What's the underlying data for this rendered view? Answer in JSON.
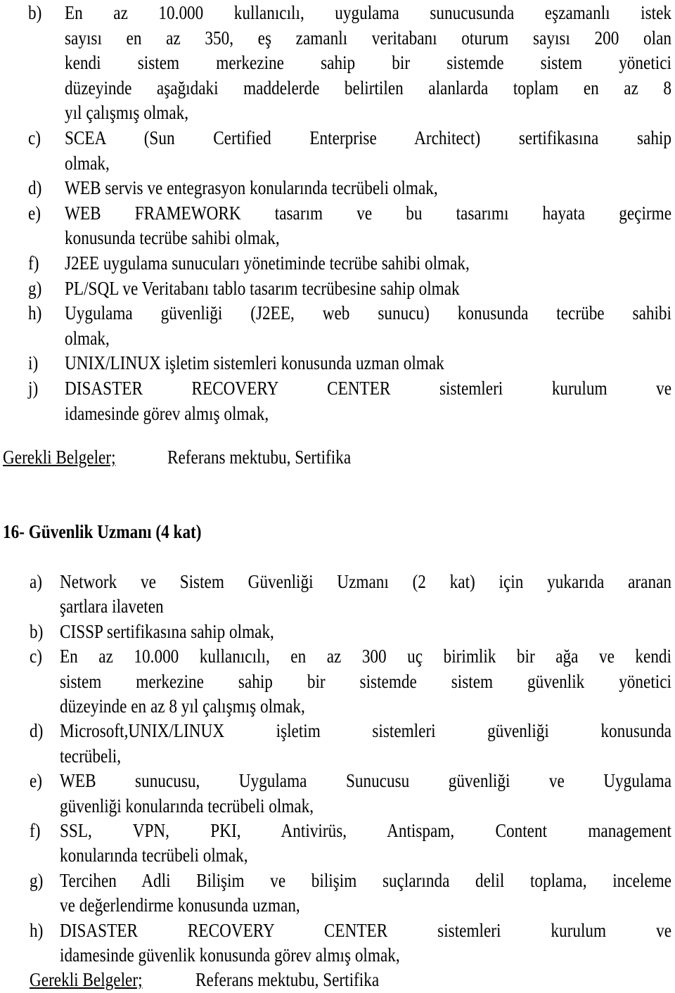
{
  "section1": {
    "items": [
      {
        "label": "b)",
        "lines": [
          "En az 10.000 kullanıcılı, uygulama sunucusunda eşzamanlı istek",
          "sayısı en az 350, eş zamanlı veritabanı oturum sayısı 200 olan",
          "kendi sistem merkezine sahip bir sistemde sistem yönetici",
          "düzeyinde aşağıdaki maddelerde belirtilen alanlarda toplam en az 8",
          "yıl çalışmış olmak,"
        ]
      },
      {
        "label": "c)",
        "lines": [
          "SCEA (Sun Certified Enterprise Architect) sertifikasına sahip",
          "olmak,"
        ]
      },
      {
        "label": "d)",
        "lines": [
          "WEB servis ve entegrasyon konularında tecrübeli olmak,"
        ]
      },
      {
        "label": "e)",
        "lines": [
          "WEB FRAMEWORK tasarım ve bu tasarımı hayata geçirme",
          "konusunda tecrübe sahibi olmak,"
        ]
      },
      {
        "label": "f)",
        "lines": [
          "J2EE uygulama sunucuları yönetiminde tecrübe sahibi olmak,"
        ]
      },
      {
        "label": "g)",
        "lines": [
          "PL/SQL ve Veritabanı tablo tasarım tecrübesine sahip olmak"
        ]
      },
      {
        "label": "h)",
        "lines": [
          "Uygulama güvenliği (J2EE, web sunucu) konusunda tecrübe sahibi",
          "olmak,"
        ]
      },
      {
        "label": "i)",
        "lines": [
          "UNIX/LINUX işletim sistemleri konusunda uzman olmak"
        ]
      },
      {
        "label": "j)",
        "lines": [
          "DISASTER RECOVERY CENTER sistemleri kurulum ve",
          "idamesinde görev almış olmak,"
        ]
      }
    ],
    "required_docs_label": "Gerekli Belgeler;",
    "required_docs_value": "Referans mektubu, Sertifika"
  },
  "section2": {
    "heading": "16- Güvenlik Uzmanı (4 kat)",
    "items": [
      {
        "label": "a)",
        "lines": [
          "Network ve Sistem Güvenliği Uzmanı (2  kat) için yukarıda aranan",
          "şartlara ilaveten"
        ]
      },
      {
        "label": "b)",
        "lines": [
          "CISSP sertifikasına sahip olmak,"
        ]
      },
      {
        "label": "c)",
        "lines": [
          "En az 10.000 kullanıcılı, en az 300 uç birimlik bir ağa ve kendi",
          "sistem merkezine sahip bir sistemde sistem güvenlik yönetici",
          "düzeyinde en az 8 yıl çalışmış olmak,"
        ]
      },
      {
        "label": "d)",
        "lines": [
          "Microsoft,UNIX/LINUX işletim sistemleri güvenliği konusunda",
          "tecrübeli,"
        ]
      },
      {
        "label": "e)",
        "lines": [
          "WEB sunucusu, Uygulama Sunucusu güvenliği ve Uygulama",
          "güvenliği konularında tecrübeli olmak,"
        ]
      },
      {
        "label": "f)",
        "lines": [
          "SSL, VPN, PKI, Antivirüs, Antispam, Content management",
          "konularında tecrübeli olmak,"
        ]
      },
      {
        "label": "g)",
        "lines": [
          "Tercihen Adli Bilişim ve bilişim suçlarında delil toplama, inceleme",
          "ve değerlendirme konusunda uzman,"
        ]
      },
      {
        "label": "h)",
        "lines": [
          "DISASTER RECOVERY CENTER sistemleri kurulum ve",
          "idamesinde güvenlik konusunda görev almış olmak,"
        ]
      }
    ],
    "required_docs_label": "Gerekli Belgeler;",
    "required_docs_value": "Referans mektubu, Sertifika"
  }
}
